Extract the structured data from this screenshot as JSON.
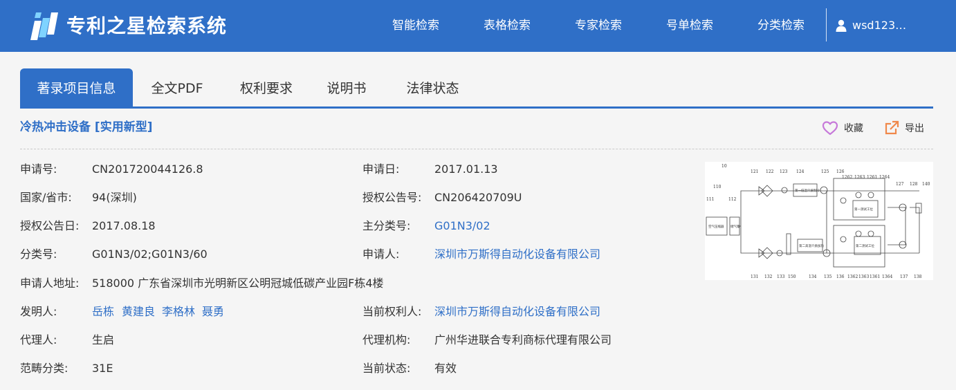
{
  "header": {
    "brand": "专利之星检索系统",
    "nav": [
      "智能检索",
      "表格检索",
      "专家检索",
      "号单检索",
      "分类检索"
    ],
    "user": "wsd123…"
  },
  "tabs": [
    "著录项目信息",
    "全文PDF",
    "权利要求",
    "说明书",
    "法律状态"
  ],
  "title": "冷热冲击设备 [实用新型]",
  "actions": {
    "favorite": "收藏",
    "export": "导出"
  },
  "fields": {
    "application_no": {
      "label": "申请号:",
      "value": "CN201720044126.8"
    },
    "application_date": {
      "label": "申请日:",
      "value": "2017.01.13"
    },
    "country_province": {
      "label": "国家/省市:",
      "value": "94(深圳)"
    },
    "grant_pub_no": {
      "label": "授权公告号:",
      "value": "CN206420709U"
    },
    "grant_pub_date": {
      "label": "授权公告日:",
      "value": "2017.08.18"
    },
    "main_class": {
      "label": "主分类号:",
      "value": "G01N3/02"
    },
    "class_no": {
      "label": "分类号:",
      "value": "G01N3/02;G01N3/60"
    },
    "applicant": {
      "label": "申请人:",
      "value": "深圳市万斯得自动化设备有限公司"
    },
    "applicant_address": {
      "label": "申请人地址:",
      "value": "518000 广东省深圳市光明新区公明冠城低碳产业园F栋4楼"
    },
    "inventors": {
      "label": "发明人:",
      "values": [
        "岳栋",
        "黄建良",
        "李格林",
        "聂勇"
      ]
    },
    "current_owner": {
      "label": "当前权利人:",
      "value": "深圳市万斯得自动化设备有限公司"
    },
    "agent": {
      "label": "代理人:",
      "value": "生启"
    },
    "agency": {
      "label": "代理机构:",
      "value": "广州华进联合专利商标代理有限公司"
    },
    "category": {
      "label": "范畴分类:",
      "value": "31E"
    },
    "status": {
      "label": "当前状态:",
      "value": "有效"
    }
  },
  "drawing": {
    "labels": [
      "10",
      "110",
      "111",
      "112",
      "121",
      "122",
      "123",
      "124",
      "125",
      "126",
      "1262",
      "1263",
      "1261",
      "1264",
      "127",
      "128",
      "140",
      "131",
      "132",
      "133",
      "150",
      "134",
      "135",
      "136",
      "1362",
      "1363",
      "1361",
      "1364",
      "137",
      "138"
    ],
    "boxes": [
      "空气压缩器",
      "储气罐",
      "第一低温介质制冷",
      "第二高温介质加热",
      "第一测试工位",
      "第二测试工位"
    ]
  },
  "colors": {
    "primary": "#2f6fc7",
    "favorite": "#c678d9",
    "export": "#f0884a"
  },
  "icons": {
    "favorite": "heart-icon",
    "export": "export-icon",
    "user": "user-icon",
    "logo": "logo-icon"
  }
}
